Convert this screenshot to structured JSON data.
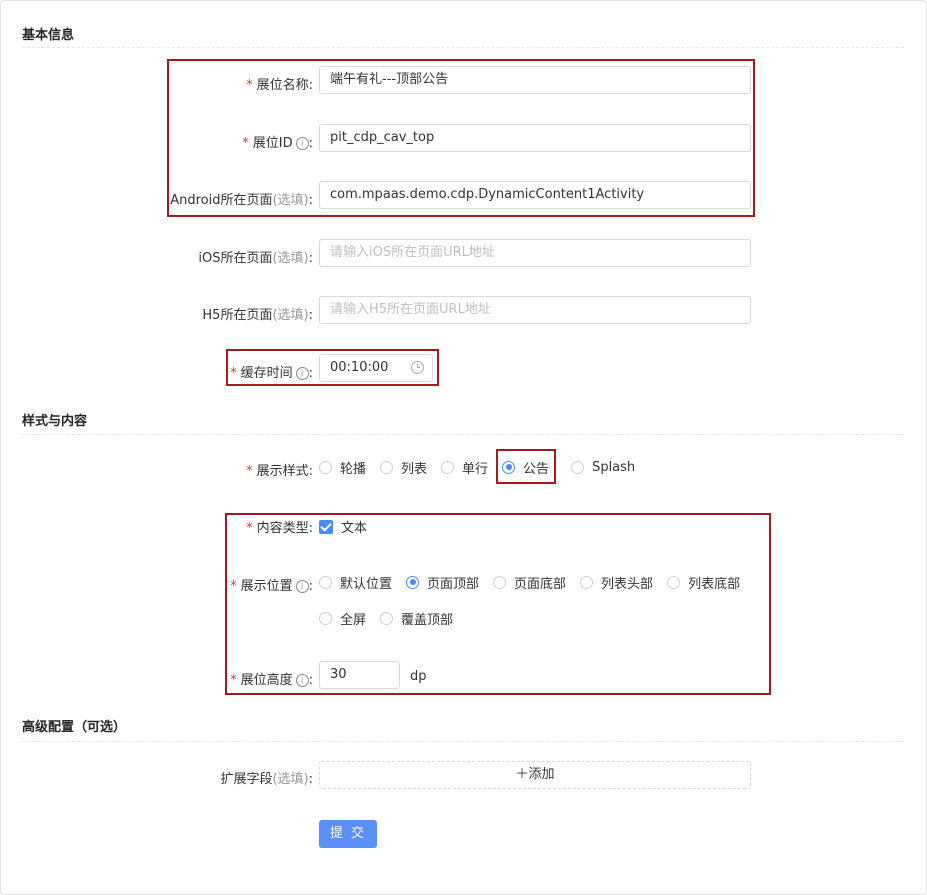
{
  "sections": {
    "basic": "基本信息",
    "style": "样式与内容",
    "advanced": "高级配置（可选）"
  },
  "fields": {
    "name": {
      "label": "展位名称:",
      "value": "端午有礼---顶部公告"
    },
    "pit_id": {
      "label": "展位ID",
      "colon": ":",
      "value": "pit_cdp_cav_top"
    },
    "android": {
      "label": "Android所在页面",
      "optional": "(选填)",
      "colon": ":",
      "value": "com.mpaas.demo.cdp.DynamicContent1Activity"
    },
    "ios": {
      "label": "iOS所在页面",
      "optional": "(选填)",
      "colon": ":",
      "placeholder": "请输入iOS所在页面URL地址"
    },
    "h5": {
      "label": "H5所在页面",
      "optional": "(选填)",
      "colon": ":",
      "placeholder": "请输入H5所在页面URL地址"
    },
    "cache": {
      "label": "缓存时间",
      "colon": ":",
      "value": "00:10:00"
    },
    "display_style": {
      "label": "展示样式:",
      "options": [
        "轮播",
        "列表",
        "单行",
        "公告",
        "Splash"
      ],
      "selected": "公告"
    },
    "content_type": {
      "label": "内容类型:",
      "option": "文本",
      "checked": true
    },
    "position": {
      "label": "展示位置",
      "colon": ":",
      "options_row1": [
        "默认位置",
        "页面顶部",
        "页面底部",
        "列表头部",
        "列表底部"
      ],
      "options_row2": [
        "全屏",
        "覆盖顶部"
      ],
      "selected": "页面顶部"
    },
    "height": {
      "label": "展位高度",
      "colon": ":",
      "value": "30",
      "unit": "dp"
    },
    "extension": {
      "label": "扩展字段",
      "optional": "(选填)",
      "colon": ":",
      "add_label": "＋添加"
    }
  },
  "submit_label": "提 交",
  "icons": {
    "info": "info-circle-icon",
    "clock": "clock-icon",
    "check": "check-icon"
  },
  "colors": {
    "required": "#e0352b",
    "primary": "#5b8ff9",
    "highlight_box": "#a31b1f"
  }
}
